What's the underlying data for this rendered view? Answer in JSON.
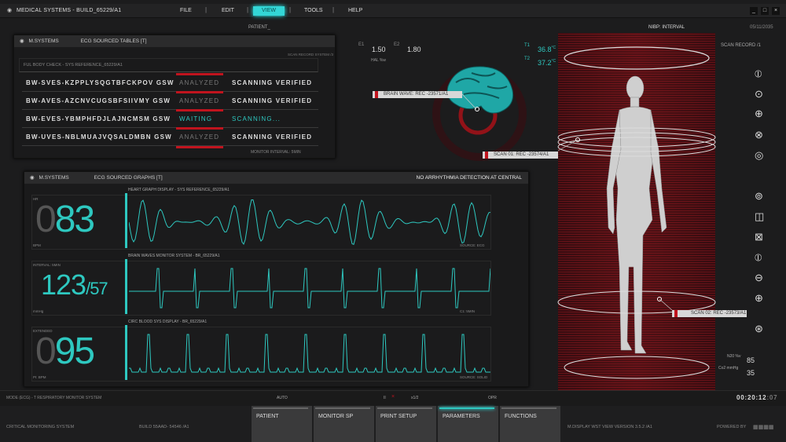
{
  "app": {
    "title": "MEDICAL SYSTEMS - BUILD_65229/A1",
    "menu": [
      "FILE",
      "EDIT",
      "VIEW",
      "TOOLS",
      "HELP"
    ],
    "active_menu": "VIEW",
    "window_buttons": [
      "_",
      "□",
      "×"
    ]
  },
  "header": {
    "patient": "PATIENT_",
    "nibp": "NIBP: INTERVAL",
    "date": "05/11/2035"
  },
  "tables_panel": {
    "brand": "M.SYSTEMS",
    "title": "ECG SOURCED TABLES [T]",
    "subtitle": "SCAN RECORD SYSTEM /3",
    "section": "FUL BODY CHECK - SYS REFERENCE_65229/A1",
    "rows": [
      {
        "id": "BW-SVES-KZPPLYSQGTBFCKPOV GSW",
        "status": "ANALYZED",
        "result": "SCANNING VERIFIED"
      },
      {
        "id": "BW-AVES-AZCNVCUGSBFSIIVMY GSW",
        "status": "ANALYZED",
        "result": "SCANNING VERIFIED"
      },
      {
        "id": "BW-EVES-YBMPHFDJLAJNCMSM GSW",
        "status": "WAITING",
        "result": "SCANNING..."
      },
      {
        "id": "BW-UVES-NBLMUAJVQSALDMBN GSW",
        "status": "ANALYZED",
        "result": "SCANNING VERIFIED"
      }
    ],
    "footer": "MONITOR INTERVAL: 5MIN"
  },
  "graphs_panel": {
    "brand": "M.SYSTEMS",
    "title": "ECG SOURCED GRAPHS [T]",
    "alert": "NO ARRHYTHMIA DETECTION AT CENTRAL",
    "graphs": [
      {
        "title": "HEART GRAPH DISPLAY - SYS REFERENCE_65229/A1",
        "label": "HR",
        "unit": "BPM",
        "dim": "0",
        "value": "83",
        "source": "SOURCE: ECG"
      },
      {
        "title": "BRAIN WAVES MONITOR SYSTEM - BR_65229/A1",
        "label": "INTERVAL: 5MIN",
        "unit": "mmHg",
        "value": "123",
        "sub": "/57",
        "source": "C1: 5MIN"
      },
      {
        "title": "CIRC BLOOD SYS DISPLAY - BR_65229/A1",
        "label": "EXTENDED",
        "unit": "PI: BPM",
        "dim": "0",
        "value": "95",
        "source": "SOURCE: SOLID"
      }
    ]
  },
  "vitals": {
    "e1_label": "E1",
    "e1": "1.50",
    "e2_label": "E2",
    "e2": "1.80",
    "hal": "HAL %w",
    "t1_label": "T1",
    "t1": "36.8",
    "t2_label": "T2",
    "t2": "37.2",
    "temp_unit": "°C",
    "n2o_label": "N20 %v",
    "n2o": "85",
    "co2_label": "Co2 mmHg",
    "co2": "35"
  },
  "scan": {
    "record": "SCAN RECORD /1",
    "brain_tag": "BRAIN WAVE: REC -23571/A1",
    "scan1_tag": "SCAN 01: REC -23574/A1",
    "scan2_tag": "SCAN 02: REC -23573/A1"
  },
  "tools": [
    "circle-line-icon",
    "circle-dot-icon",
    "circle-plus-icon",
    "circle-x-icon",
    "circle-target-icon",
    "circle-eye-icon",
    "split-square-icon",
    "cross-box-icon",
    "circle-vert-icon",
    "circle-minus-icon",
    "circle-cross-icon",
    "circle-sun-icon"
  ],
  "status": {
    "left": "MODE (ECG) - T    RESPIRATORY MONITOR SYSTEM",
    "auto": "AUTO",
    "ii": "II",
    "x": "×",
    "scale": "x1/2",
    "opr": "OPR",
    "clock": "00:20:12",
    "clock_ms": ":07"
  },
  "footer": {
    "system": "CRITICAL MONITORING SYSTEM",
    "build": "BUILD 55AAD- 54546 /A1",
    "version": "M.DISPLAY WST VIEW VERSION 3.5.2 /A1",
    "powered": "POWERED BY",
    "tabs": [
      "PATIENT",
      "MONITOR SP",
      "PRINT SETUP",
      "PARAMETERS",
      "FUNCTIONS"
    ],
    "active_tab": "PARAMETERS"
  },
  "colors": {
    "accent": "#2ec8c0",
    "alert": "#c0141e",
    "bg": "#1c1c1d"
  }
}
